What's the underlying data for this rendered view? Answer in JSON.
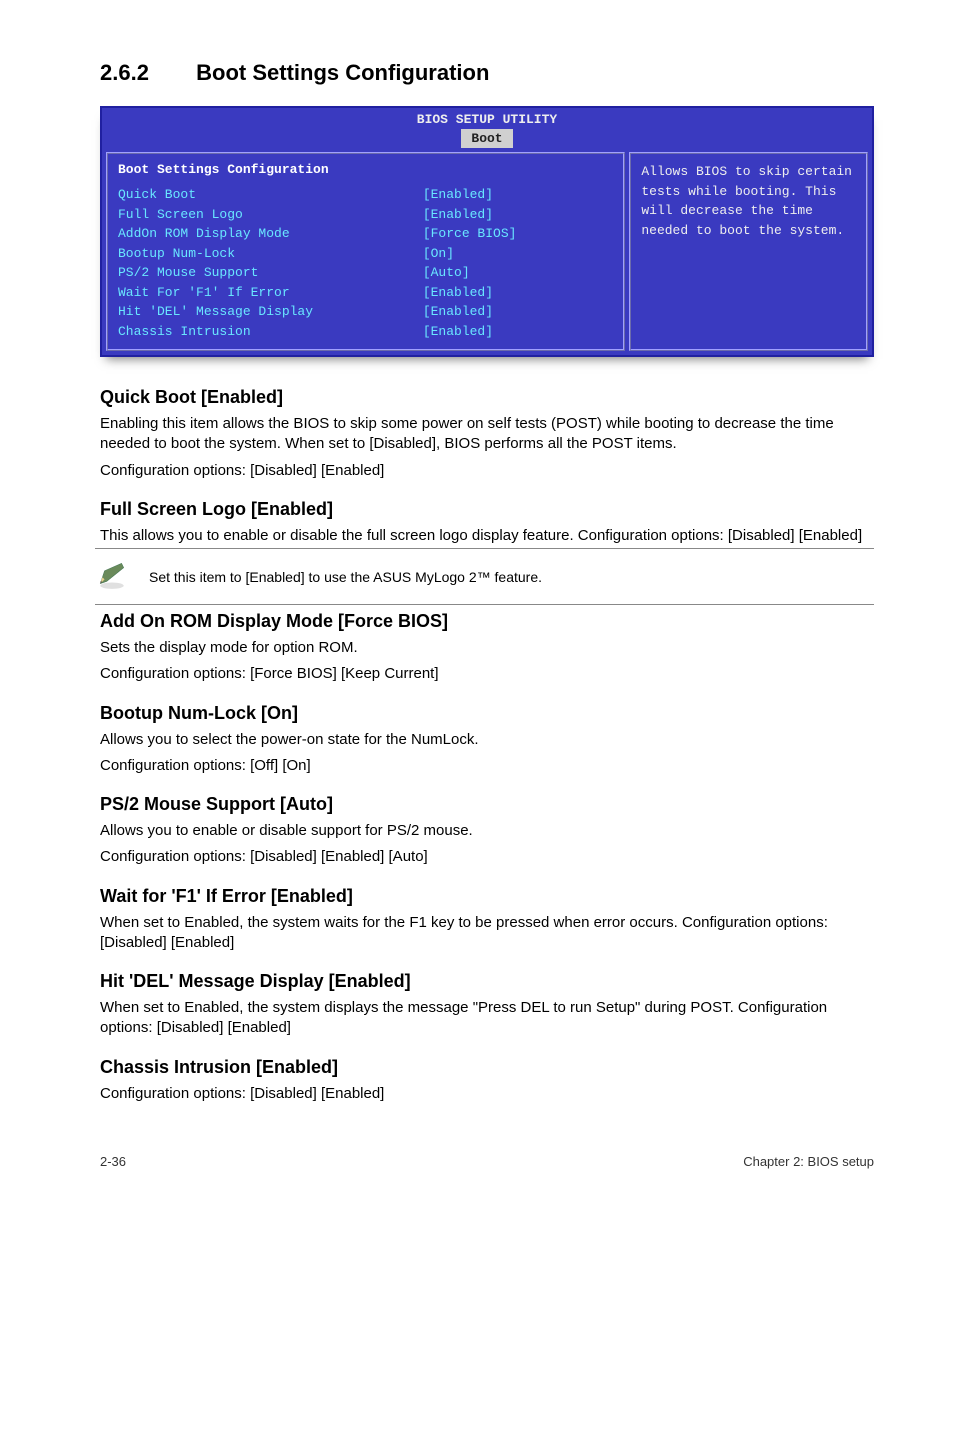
{
  "section": {
    "number": "2.6.2",
    "title": "Boot Settings Configuration"
  },
  "bios": {
    "utility_title": "BIOS SETUP UTILITY",
    "tab": "Boot",
    "panel_title": "Boot Settings Configuration",
    "rows": [
      {
        "label": "Quick Boot",
        "value": "[Enabled]"
      },
      {
        "label": "Full Screen Logo",
        "value": "[Enabled]"
      },
      {
        "label": "AddOn ROM Display Mode",
        "value": "[Force BIOS]"
      },
      {
        "label": "Bootup Num-Lock",
        "value": "[On]"
      },
      {
        "label": "PS/2 Mouse Support",
        "value": "[Auto]"
      },
      {
        "label": "Wait For 'F1' If Error",
        "value": "[Enabled]"
      },
      {
        "label": "Hit 'DEL' Message Display",
        "value": "[Enabled]"
      },
      {
        "label": "Chassis Intrusion",
        "value": "[Enabled]"
      }
    ],
    "help": "Allows BIOS to skip certain tests while booting. This will decrease the time needed to boot the system."
  },
  "items": [
    {
      "title": "Quick Boot [Enabled]",
      "paras": [
        "Enabling this item allows the BIOS to skip some power on self tests (POST) while booting to decrease the time needed to boot the system. When set to [Disabled], BIOS performs all the POST items.",
        "Configuration options: [Disabled] [Enabled]"
      ]
    },
    {
      "title": "Full Screen Logo [Enabled]",
      "paras": [
        "This allows you to enable or disable the full screen logo display feature. Configuration options: [Disabled] [Enabled]"
      ],
      "note": "Set this item to [Enabled] to use the ASUS MyLogo 2™ feature."
    },
    {
      "title": "Add On ROM Display Mode [Force BIOS]",
      "paras": [
        "Sets the display mode for option ROM.",
        "Configuration options: [Force BIOS] [Keep Current]"
      ]
    },
    {
      "title": "Bootup Num-Lock [On]",
      "paras": [
        "Allows you to select the power-on state for the NumLock.",
        "Configuration options: [Off] [On]"
      ]
    },
    {
      "title": "PS/2 Mouse Support [Auto]",
      "paras": [
        "Allows you to enable or disable support for PS/2 mouse.",
        "Configuration options: [Disabled] [Enabled] [Auto]"
      ]
    },
    {
      "title": "Wait for 'F1' If Error [Enabled]",
      "paras": [
        "When set to Enabled, the system waits for the F1 key to be pressed when error occurs. Configuration options: [Disabled] [Enabled]"
      ]
    },
    {
      "title": "Hit 'DEL' Message Display [Enabled]",
      "paras": [
        "When set to Enabled, the system displays the message \"Press DEL to run Setup\" during POST. Configuration options: [Disabled] [Enabled]"
      ]
    },
    {
      "title": "Chassis Intrusion [Enabled]",
      "paras": [
        "Configuration options: [Disabled] [Enabled]"
      ]
    }
  ],
  "footer": {
    "left": "2-36",
    "right": "Chapter 2: BIOS setup"
  }
}
